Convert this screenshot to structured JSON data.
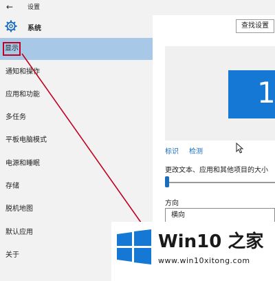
{
  "titlebar": {
    "title": "设置"
  },
  "sidebar": {
    "header": "系统",
    "items": [
      {
        "label": "显示",
        "selected": true
      },
      {
        "label": "通知和操作"
      },
      {
        "label": "应用和功能"
      },
      {
        "label": "多任务"
      },
      {
        "label": "平板电脑模式"
      },
      {
        "label": "电源和睡眠"
      },
      {
        "label": "存储"
      },
      {
        "label": "脱机地图"
      },
      {
        "label": "默认应用"
      },
      {
        "label": "关于"
      }
    ]
  },
  "main": {
    "search_label": "查找设置",
    "monitor_number": "1",
    "identify_label": "标识",
    "detect_label": "检测",
    "scale_label": "更改文本、应用和其他项目的大小",
    "orientation_label": "方向",
    "orientation_value": "横向"
  },
  "watermark": {
    "brand": "Win10 之家",
    "url": "www.win10xitong.com"
  },
  "colors": {
    "accent": "#1478d4",
    "selected_bg": "#a8c8e8",
    "annotation": "#c0001e",
    "link": "#1a6dbb"
  }
}
